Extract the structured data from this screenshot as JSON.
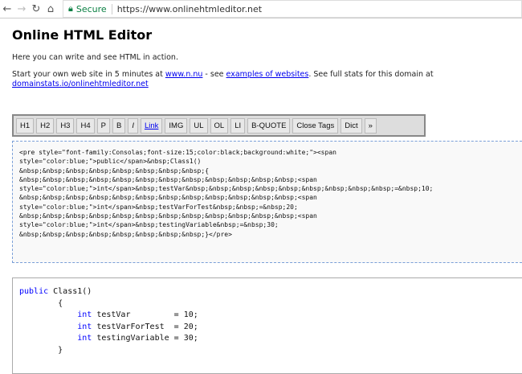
{
  "browser": {
    "security_label": "Secure",
    "url": "https://www.onlinehtmleditor.net"
  },
  "page": {
    "title": "Online HTML Editor",
    "intro": "Here you can write and see HTML in action.",
    "start_text_1": "Start your own web site in 5 minutes at ",
    "link_nnu": "www.n.nu",
    "start_text_2": " - see ",
    "link_examples": "examples of websites",
    "start_text_3": ". See full stats for this domain at ",
    "link_stats": "domainstats.io/onlinehtmleditor.net"
  },
  "toolbar": [
    "H1",
    "H2",
    "H3",
    "H4",
    "P",
    "B",
    "I",
    "Link",
    "IMG",
    "UL",
    "OL",
    "LI",
    "B-QUOTE",
    "Close Tags",
    "Dict",
    "»"
  ],
  "editor": {
    "lines": [
      "<pre style=\"font-family:Consolas;font-size:15;color:black;background:white;\"><span",
      "style=\"color:blue;\">public</span>&nbsp;Class1()",
      "&nbsp;&nbsp;&nbsp;&nbsp;&nbsp;&nbsp;&nbsp;&nbsp;{",
      "&nbsp;&nbsp;&nbsp;&nbsp;&nbsp;&nbsp;&nbsp;&nbsp;&nbsp;&nbsp;&nbsp;&nbsp;<span",
      "style=\"color:blue;\">int</span>&nbsp;testVar&nbsp;&nbsp;&nbsp;&nbsp;&nbsp;&nbsp;&nbsp;&nbsp;&nbsp;=&nbsp;10;",
      "&nbsp;&nbsp;&nbsp;&nbsp;&nbsp;&nbsp;&nbsp;&nbsp;&nbsp;&nbsp;&nbsp;&nbsp;<span",
      "style=\"color:blue;\">int</span>&nbsp;testVarForTest&nbsp;&nbsp;=&nbsp;20;",
      "&nbsp;&nbsp;&nbsp;&nbsp;&nbsp;&nbsp;&nbsp;&nbsp;&nbsp;&nbsp;&nbsp;&nbsp;<span",
      "style=\"color:blue;\">int</span>&nbsp;testingVariable&nbsp;=&nbsp;30;",
      "&nbsp;&nbsp;&nbsp;&nbsp;&nbsp;&nbsp;&nbsp;&nbsp;}</pre>"
    ]
  },
  "output": {
    "kw_public": "public",
    "l1": " Class1()",
    "l2": "        {",
    "ind": "            ",
    "kw_int": "int",
    "v1": " testVar         = 10;",
    "v2": " testVarForTest  = 20;",
    "v3": " testingVariable = 30;",
    "l6": "        }"
  }
}
